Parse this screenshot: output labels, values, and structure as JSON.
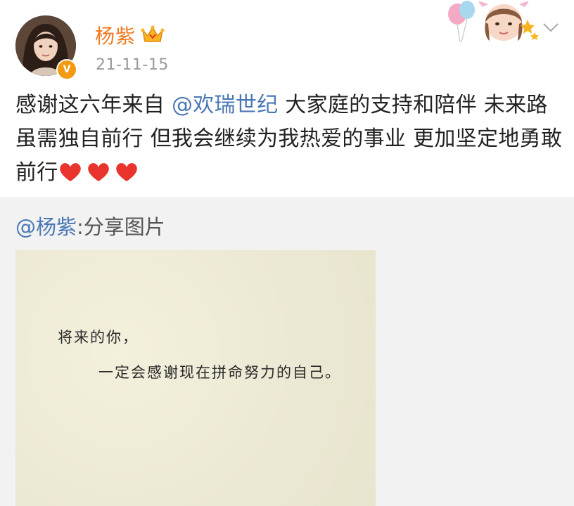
{
  "post": {
    "username": "杨紫",
    "date": "21-11-15",
    "verify_mark": "V",
    "text_part1": "感谢这六年来自 ",
    "mention": "@欢瑞世纪",
    "text_part2": " 大家庭的支持和陪伴 未来路 虽需独自前行 但我会继续为我热爱的事业 更加坚定地勇敢前行",
    "hearts": [
      "heart-icon",
      "heart-icon",
      "heart-icon"
    ]
  },
  "repost": {
    "user": "@杨紫",
    "text": ":分享图片"
  },
  "image": {
    "line1": "将来的你，",
    "line2": "一定会感谢现在拼命努力的自己。"
  },
  "colors": {
    "username": "#f07a22",
    "link": "#4a78b5",
    "date": "#9a9a9a",
    "heart": "#e8342c",
    "repost_bg": "#f2f2f2"
  }
}
